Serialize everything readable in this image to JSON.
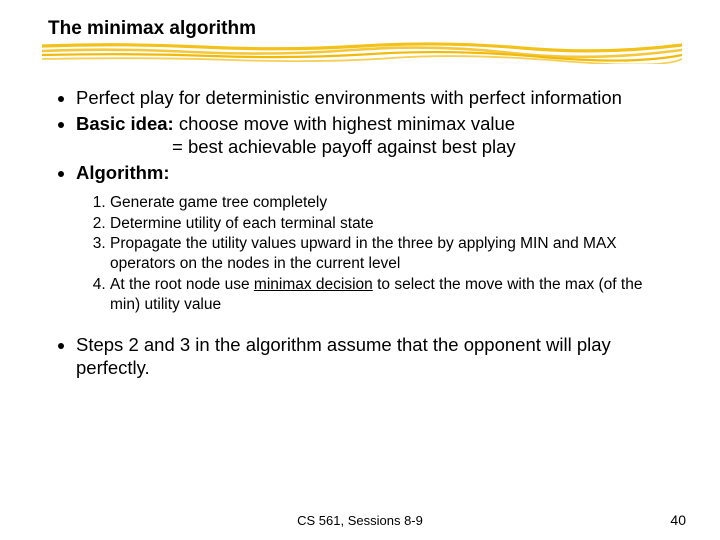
{
  "title": "The minimax algorithm",
  "bullets": {
    "b1": "Perfect play for deterministic environments with perfect information",
    "b2_label": "Basic idea:",
    "b2_rest": " choose move with highest minimax value",
    "b2_line2": "= best achievable payoff against best play",
    "b3_label": "Algorithm:"
  },
  "steps": {
    "s1": "Generate game tree completely",
    "s2": "Determine utility of each terminal state",
    "s3": "Propagate the utility values upward in the three by applying MIN and MAX operators on the nodes in the current level",
    "s4a": "At the root node use ",
    "s4u": "minimax decision",
    "s4b": " to select the move with the max (of the min) utility value"
  },
  "closing": "Steps 2 and 3 in the algorithm assume that the opponent will play perfectly.",
  "footer": {
    "course": "CS 561, Sessions 8-9",
    "page": "40"
  }
}
